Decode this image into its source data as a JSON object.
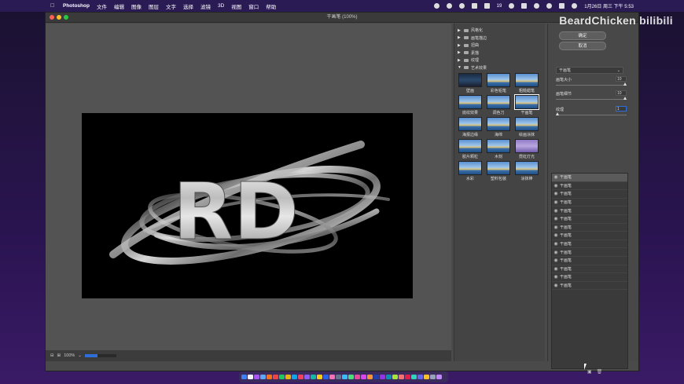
{
  "menubar": {
    "app": "Photoshop",
    "items": [
      "文件",
      "编辑",
      "图像",
      "图层",
      "文字",
      "选择",
      "滤镜",
      "3D",
      "视图",
      "窗口",
      "帮助"
    ],
    "clock": "1月26日 周三 下午 5:53",
    "battery": "19"
  },
  "window": {
    "title": "干画笔 (100%)"
  },
  "canvas": {
    "artwork_text": "RD"
  },
  "status": {
    "zoom": "100%",
    "progress": 0.4
  },
  "filter_gallery": {
    "categories": [
      {
        "label": "风格化",
        "expanded": false
      },
      {
        "label": "画笔描边",
        "expanded": false
      },
      {
        "label": "扭曲",
        "expanded": false
      },
      {
        "label": "素描",
        "expanded": false
      },
      {
        "label": "纹理",
        "expanded": false
      },
      {
        "label": "艺术效果",
        "expanded": true
      }
    ],
    "thumbs": [
      {
        "label": "壁画",
        "style": "dark"
      },
      {
        "label": "彩色铅笔",
        "style": "sky"
      },
      {
        "label": "粗糙蜡笔",
        "style": "sky"
      },
      {
        "label": "底纹效果",
        "style": "sky"
      },
      {
        "label": "调色刀",
        "style": "sky"
      },
      {
        "label": "干画笔",
        "style": "sky",
        "selected": true
      },
      {
        "label": "海报边缘",
        "style": "sky"
      },
      {
        "label": "海绵",
        "style": "sky"
      },
      {
        "label": "绘画涂抹",
        "style": "sky"
      },
      {
        "label": "胶片颗粒",
        "style": "sky"
      },
      {
        "label": "木刻",
        "style": "sky"
      },
      {
        "label": "霓虹灯光",
        "style": "purple"
      },
      {
        "label": "水彩",
        "style": "sky"
      },
      {
        "label": "塑料包装",
        "style": "sky"
      },
      {
        "label": "涂抹棒",
        "style": "sky"
      }
    ]
  },
  "settings": {
    "ok_label": "确定",
    "cancel_label": "取消",
    "filter_select": "干画笔",
    "params": [
      {
        "label": "画笔大小",
        "value": "10",
        "level": 1.0
      },
      {
        "label": "画笔细节",
        "value": "10",
        "level": 1.0
      },
      {
        "label": "纹理",
        "value": "1",
        "level": 0.0
      }
    ],
    "layers": [
      "干画笔",
      "干画笔",
      "干画笔",
      "干画笔",
      "干画笔",
      "干画笔",
      "干画笔",
      "干画笔",
      "干画笔",
      "干画笔",
      "干画笔",
      "干画笔",
      "干画笔",
      "干画笔"
    ]
  },
  "watermark": "BeardChicken bilibili"
}
